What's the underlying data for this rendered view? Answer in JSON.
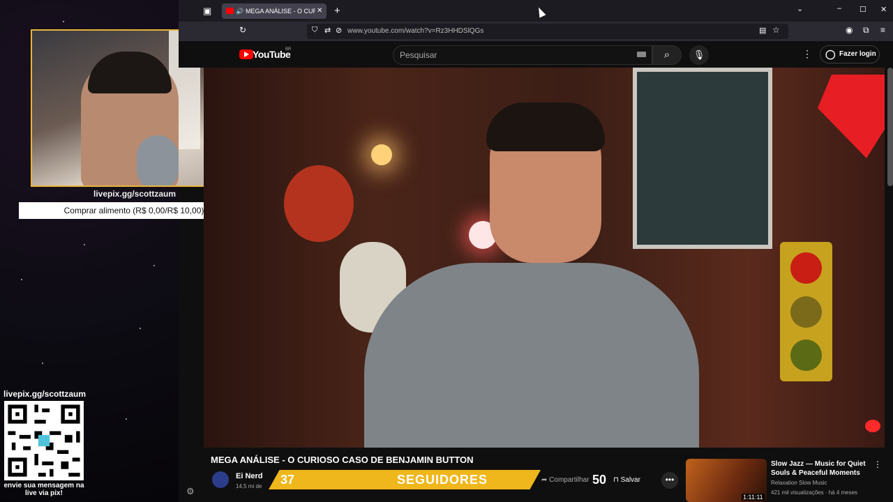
{
  "browser": {
    "tab_title": "MEGA ANÁLISE - O CURIOSO",
    "url": "www.youtube.com/watch?v=Rz3HHDSlQGs"
  },
  "overlay": {
    "cam_caption": "livepix.gg/scottzaum",
    "buy_bar": "Comprar alimento (R$ 0,00/R$ 10,00)",
    "qr_label": "livepix.gg/scottzaum",
    "qr_message": "envie sua mensagem na live via pix!",
    "followers_count": "37",
    "followers_label": "SEGUIDORES",
    "goal": "50"
  },
  "youtube": {
    "logo": "YouTube",
    "region": "BR",
    "search_placeholder": "Pesquisar",
    "login": "Fazer login",
    "video_title": "MEGA ANÁLISE - O CURIOSO CASO DE BENJAMIN BUTTON",
    "channel": "Ei Nerd",
    "subs": "14,5 mi de",
    "share": "Compartilhar",
    "save": "Salvar",
    "rec": {
      "title": "Slow Jazz — Music for Quiet Souls & Peaceful Moments",
      "channel": "Relaxation Slow Music",
      "meta": "421 mil visualizações · há 4 meses",
      "duration": "1:11:11"
    }
  }
}
